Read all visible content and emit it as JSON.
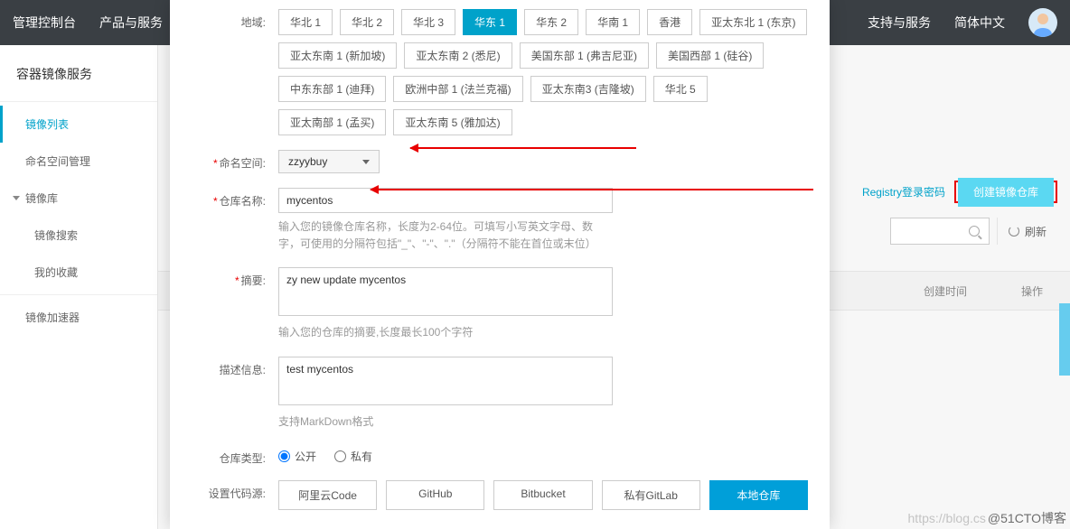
{
  "topnav": {
    "left": [
      "管理控制台",
      "产品与服务"
    ],
    "right": [
      "支持与服务",
      "简体中文"
    ]
  },
  "sidebar": {
    "service": "容器镜像服务",
    "items": [
      {
        "label": "镜像列表",
        "active": true,
        "level": 1
      },
      {
        "label": "命名空间管理",
        "level": 1
      },
      {
        "label": "镜像库",
        "group": true
      },
      {
        "label": "镜像搜索",
        "level": 2
      },
      {
        "label": "我的收藏",
        "level": 2
      },
      {
        "label": "镜像加速器",
        "level": 1,
        "sep": true
      }
    ]
  },
  "right_panel": {
    "registry_link": "Registry登录密码",
    "create_btn": "创建镜像仓库",
    "refresh": "刷新",
    "col_create_time": "创建时间",
    "col_action": "操作"
  },
  "modal": {
    "labels": {
      "region": "地域:",
      "namespace": "命名空间:",
      "repo": "仓库名称:",
      "summary": "摘要:",
      "desc": "描述信息:",
      "type": "仓库类型:",
      "source": "设置代码源:"
    },
    "regions": [
      {
        "label": "华北 1"
      },
      {
        "label": "华北 2"
      },
      {
        "label": "华北 3"
      },
      {
        "label": "华东 1",
        "selected": true
      },
      {
        "label": "华东 2"
      },
      {
        "label": "华南 1"
      },
      {
        "label": "香港"
      },
      {
        "label": "亚太东北 1 (东京)"
      },
      {
        "label": "亚太东南 1 (新加坡)"
      },
      {
        "label": "亚太东南 2 (悉尼)"
      },
      {
        "label": "美国东部 1 (弗吉尼亚)"
      },
      {
        "label": "美国西部 1 (硅谷)"
      },
      {
        "label": "中东东部 1 (迪拜)"
      },
      {
        "label": "欧洲中部 1 (法兰克福)"
      },
      {
        "label": "亚太东南3 (吉隆坡)"
      },
      {
        "label": "华北 5"
      },
      {
        "label": "亚太南部 1 (孟买)"
      },
      {
        "label": "亚太东南 5 (雅加达)"
      }
    ],
    "namespace": "zzyybuy",
    "repo_value": "mycentos",
    "repo_help": "输入您的镜像仓库名称，长度为2-64位。可填写小写英文字母、数字，可使用的分隔符包括\"_\"、\"-\"、\".\"（分隔符不能在首位或末位）",
    "summary_value": "zy new update mycentos",
    "summary_help": "输入您的仓库的摘要,长度最长100个字符",
    "desc_value": "test mycentos",
    "desc_help": "支持MarkDown格式",
    "type_public": "公开",
    "type_private": "私有",
    "sources": [
      {
        "label": "阿里云Code"
      },
      {
        "label": "GitHub"
      },
      {
        "label": "Bitbucket"
      },
      {
        "label": "私有GitLab"
      },
      {
        "label": "本地仓库",
        "selected": true
      }
    ]
  },
  "watermark": {
    "ghost": "https://blog.cs",
    "text": "@51CTO博客"
  }
}
